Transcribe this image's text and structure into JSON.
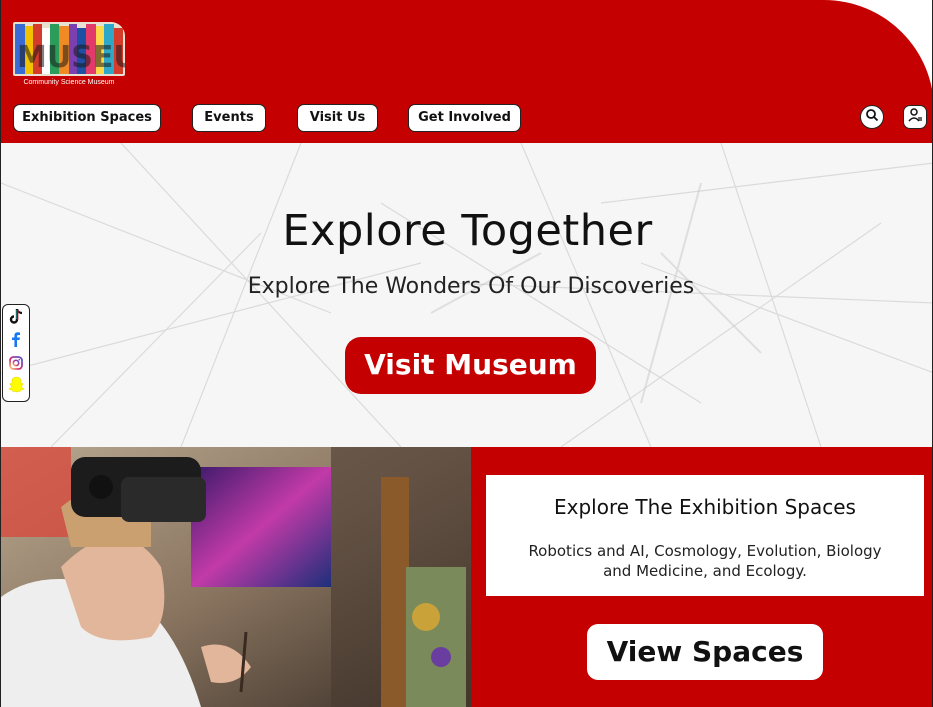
{
  "header": {
    "logo_caption": "Community Science Museum",
    "nav": [
      {
        "label": "Exhibition Spaces"
      },
      {
        "label": "Events"
      },
      {
        "label": "Visit Us"
      },
      {
        "label": "Get Involved"
      }
    ],
    "icons": [
      "search-icon",
      "user-account-icon"
    ]
  },
  "hero": {
    "title": "Explore Together",
    "subtitle": "Explore The Wonders Of Our Discoveries",
    "cta_label": "Visit Museum"
  },
  "social": {
    "icons": [
      "tiktok-icon",
      "facebook-icon",
      "instagram-icon",
      "snapchat-icon"
    ]
  },
  "exhibition": {
    "title": "Explore The Exhibition Spaces",
    "description": "Robotics and AI, Cosmology, Evolution, Biology and Medicine, and Ecology.",
    "button_label": "View Spaces"
  },
  "colors": {
    "brand_red": "#c50000",
    "white": "#ffffff",
    "text_dark": "#111111"
  }
}
